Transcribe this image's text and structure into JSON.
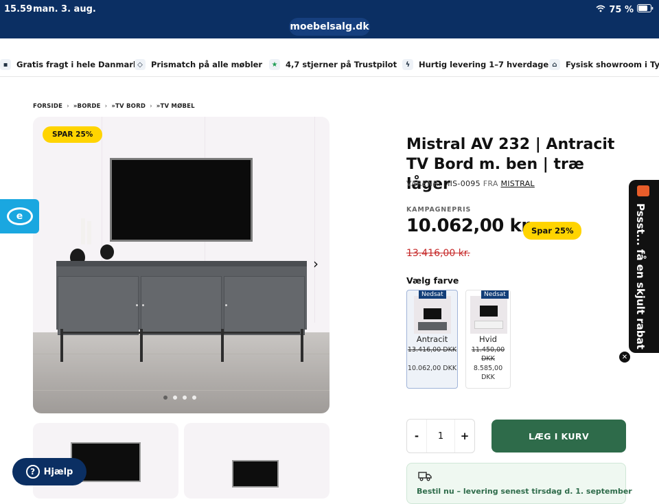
{
  "status": {
    "time": "15.59",
    "date": "man. 3. aug.",
    "battery": "75 %"
  },
  "browser": {
    "url": "moebelsalg.dk"
  },
  "usps": [
    {
      "icon": "truck-icon",
      "label": "Gratis fragt i hele Danmark"
    },
    {
      "icon": "tag-icon",
      "label": "Prismatch på alle møbler"
    },
    {
      "icon": "star-icon",
      "label": "4,7 stjerner på Trustpilot"
    },
    {
      "icon": "lightning-icon",
      "label": "Hurtig levering 1–7 hverdage"
    },
    {
      "icon": "store-icon",
      "label": "Fysisk showroom i Tylstru"
    }
  ],
  "breadcrumb": [
    "FORSIDE",
    "»BORDE",
    "»TV BORD",
    "»TV MØBEL"
  ],
  "gallery": {
    "badge": "SPAR 25%",
    "dots": 4,
    "active_dot": 0
  },
  "product": {
    "title": "Mistral AV 232 | Antracit TV Bord m. ben | træ låger",
    "sku_label": "VARENR.",
    "sku": "MIS-0095",
    "brand_prefix": "FRA",
    "brand": "MISTRAL",
    "campaign_label": "KAMPAGNEPRIS",
    "price": "10.062,00 kr.",
    "discount_badge": "Spar 25%",
    "old_price": "13.416,00 kr.",
    "color_label": "Vælg farve"
  },
  "variants": [
    {
      "name": "Antracit",
      "badge": "Nedsat",
      "old_price": "13.416,00 DKK",
      "new_price": "10.062,00 DKK",
      "selected": true
    },
    {
      "name": "Hvid",
      "badge": "Nedsat",
      "old_price": "11.450,00 DKK",
      "new_price": "8.585,00 DKK",
      "selected": false
    }
  ],
  "quantity": {
    "minus": "-",
    "value": "1",
    "plus": "+"
  },
  "cart_button": "LÆG I KURV",
  "delivery_text": "Bestil nu – levering senest tirsdag d. 1. september",
  "help_button": "Hjælp",
  "eye_letter": "e",
  "rabat_text": "Pssst... få en skjult rabat",
  "colors": {
    "header": "#0b2f63",
    "accent_yellow": "#ffd400",
    "cart_green": "#2e6b4a",
    "sale_red": "#c62828"
  }
}
